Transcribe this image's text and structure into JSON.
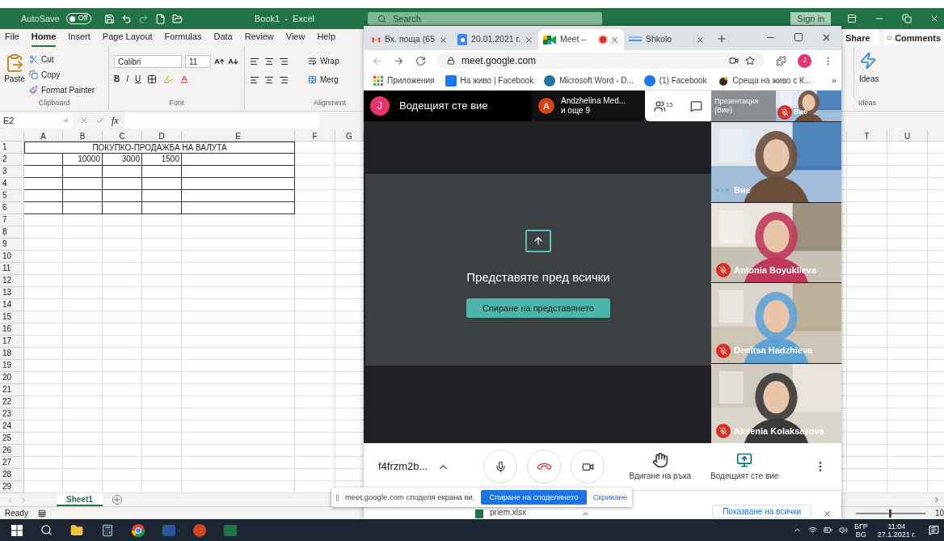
{
  "excel": {
    "title_bar": {
      "autosave": "AutoSave",
      "autosave_toggle": {
        "label": "Off",
        "on": false
      },
      "title": "Book1  -  Excel",
      "search_placeholder": "Search",
      "sign_in": "Sign in"
    },
    "menu_tabs": [
      {
        "label": "File",
        "selected": false
      },
      {
        "label": "Home",
        "selected": true
      },
      {
        "label": "Insert",
        "selected": false
      },
      {
        "label": "Page Layout",
        "selected": false
      },
      {
        "label": "Formulas",
        "selected": false
      },
      {
        "label": "Data",
        "selected": false
      },
      {
        "label": "Review",
        "selected": false
      },
      {
        "label": "View",
        "selected": false
      },
      {
        "label": "Help",
        "selected": false
      }
    ],
    "share": "Share",
    "comments": "Comments",
    "clipboard": {
      "paste": "Paste",
      "cut": "Cut",
      "copy": "Copy",
      "format_painter": "Format Painter",
      "group_label": "Clipboard"
    },
    "font": {
      "name": "Calibri",
      "size": "11",
      "bold": "B",
      "italic": "I",
      "underline": "U",
      "group_label": "Font"
    },
    "alignment": {
      "wrap": "Wrap",
      "merge": "Merg",
      "group_label": "Alignment"
    },
    "ideas": {
      "button": "Ideas",
      "group_label": "Ideas"
    },
    "name_box": "E2",
    "fx": "fx",
    "sheet": {
      "columns_left": [
        "A",
        "B",
        "C",
        "D",
        "E",
        "F",
        "G"
      ],
      "columns_right": [
        "T",
        "U"
      ],
      "rows": [
        "1",
        "2",
        "3",
        "4",
        "5",
        "6",
        "7",
        "8",
        "9",
        "10",
        "11",
        "12",
        "13",
        "14",
        "15",
        "16",
        "17",
        "18",
        "19",
        "20",
        "21",
        "22",
        "23",
        "24",
        "25",
        "26",
        "27",
        "28",
        "29"
      ],
      "title": "ПОКУПКО-ПРОДАЖБА НА ВАЛУТА",
      "row2_values": [
        "10000",
        "3000",
        "1500"
      ]
    },
    "sheet_tabs": [
      {
        "label": "Sheet1",
        "selected": true
      }
    ],
    "status": "Ready",
    "zoom_slider": {
      "level": 0.5
    },
    "zoom": "10"
  },
  "chrome": {
    "tabs": [
      {
        "kind": "mail",
        "label": "Вх. поща (65",
        "selected": false
      },
      {
        "kind": "calendar",
        "label": "20.01.2021 г.",
        "selected": false
      },
      {
        "kind": "meet",
        "label": "Meet –",
        "selected": true,
        "recording": true
      },
      {
        "kind": "school",
        "label": "Shkolo",
        "selected": false
      }
    ],
    "url": "meet.google.com",
    "bookmarks": [
      {
        "kind": "apps",
        "label": "Приложения"
      },
      {
        "kind": "facebook",
        "label": "На живо | Facebook"
      },
      {
        "kind": "wordpress",
        "label": "Microsoft Word - D..."
      },
      {
        "kind": "facebook_round",
        "label": "(1) Facebook"
      },
      {
        "kind": "bowl",
        "label": "Среща на живо с К..."
      }
    ],
    "more_bookmarks": "»",
    "profile": "J"
  },
  "meet": {
    "presenter": {
      "avatar": "J",
      "text": "Водещият сте вие"
    },
    "participants_pill": {
      "avatar": "A",
      "name": "Andzhelina Med...",
      "more": "и още 9"
    },
    "people_count": "15",
    "presentation_tile": {
      "line1": "Презентация",
      "line2": "(Вие)"
    },
    "self_mini": {
      "name": "Вие",
      "muted": true
    },
    "sharing": {
      "message": "Представяте пред всички",
      "button": "Спиране на представянето"
    },
    "tiles": [
      {
        "name": "Вие",
        "muted": false
      },
      {
        "name": "Antonia Boyuklieva",
        "muted": true
      },
      {
        "name": "Denitsa Hadzhieva",
        "muted": true
      },
      {
        "name": "Aksenia Kolaksazova",
        "muted": true
      }
    ],
    "meeting_code": "f4frzm2b...",
    "actions": [
      {
        "kind": "hand",
        "label": "Вдигане на ръка"
      },
      {
        "kind": "present",
        "label": "Водещият сте вие"
      }
    ]
  },
  "share_notice": {
    "text": "meet.google.com споделя екрана ви.",
    "stop": "Спиране на споделянето",
    "hide": "Скриване"
  },
  "downloads": {
    "file": "priem.xlsx",
    "show_all": "Показване на всички"
  },
  "taskbar": {
    "lang1": "БГР",
    "lang2": "BG",
    "time": "11:04",
    "date": "27.1.2021 г."
  }
}
